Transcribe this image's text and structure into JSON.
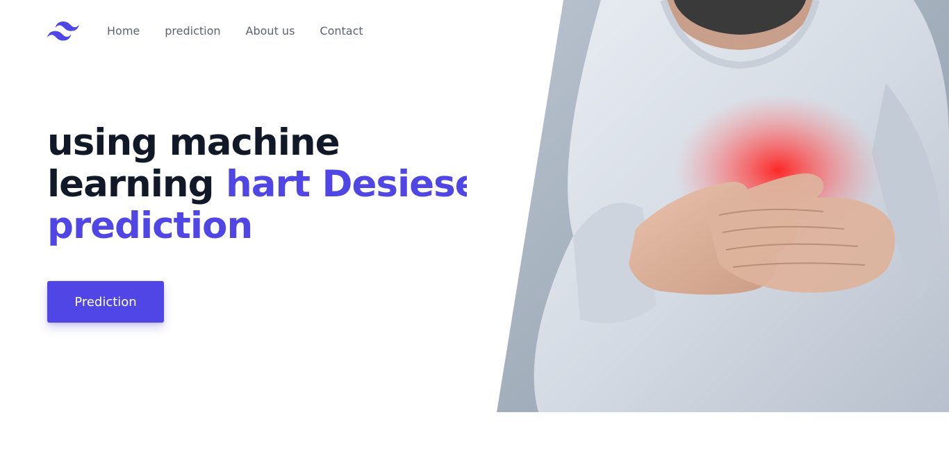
{
  "nav": {
    "logo_icon": "tailwind-wave-logo-icon",
    "links": [
      "Home",
      "prediction",
      "About us",
      "Contact"
    ]
  },
  "hero": {
    "title_line1": "using machine",
    "title_line2_plain": "learning",
    "title_line2_accent": "hart Desiese",
    "title_line3_accent": "prediction",
    "cta_label": "Prediction"
  },
  "image": {
    "subject": "man-clutching-chest-photo",
    "pain_glow_color": "#ff2a2a"
  },
  "colors": {
    "accent": "#4f46e5",
    "heading": "#111827",
    "nav_text": "#5b6270",
    "background": "#ffffff"
  }
}
